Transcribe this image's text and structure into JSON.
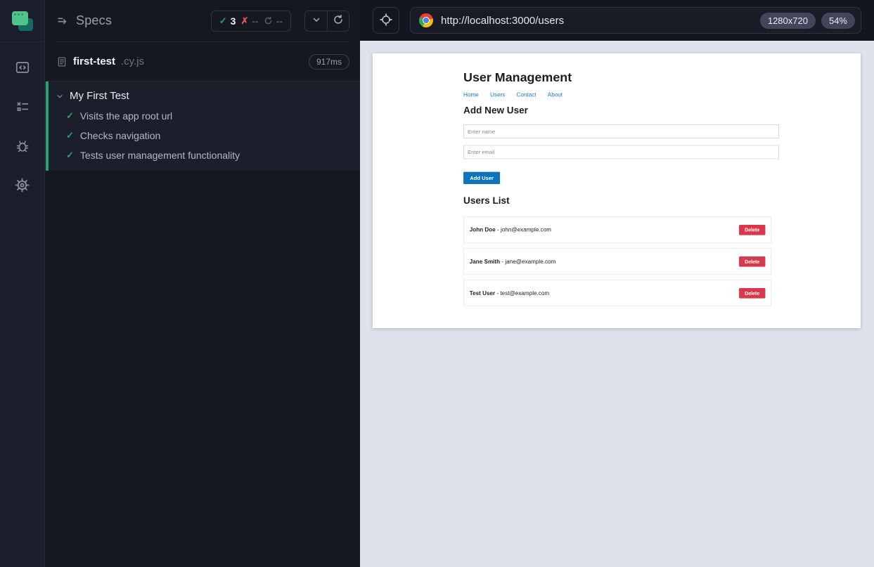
{
  "sidebar": {
    "icons": [
      "cypress-logo",
      "specs-window-icon",
      "runs-checklist-icon",
      "debug-bug-icon",
      "settings-gear-icon"
    ]
  },
  "specs_panel": {
    "title": "Specs",
    "stats": {
      "passed": "3",
      "failed": "--",
      "pending": "--"
    },
    "spec_file": {
      "name": "first-test",
      "extension": ".cy.js",
      "duration": "917ms"
    },
    "suite": {
      "title": "My First Test",
      "tests": [
        {
          "label": "Visits the app root url",
          "status": "passed"
        },
        {
          "label": "Checks navigation",
          "status": "passed"
        },
        {
          "label": "Tests user management functionality",
          "status": "passed"
        }
      ]
    }
  },
  "browser_bar": {
    "url": "http://localhost:3000/users",
    "viewport_size": "1280x720",
    "zoom_level": "54%"
  },
  "aut": {
    "title": "User Management",
    "nav": [
      "Home",
      "Users",
      "Contact",
      "About"
    ],
    "form": {
      "heading": "Add New User",
      "name_placeholder": "Enter name",
      "email_placeholder": "Enter email",
      "submit_label": "Add User"
    },
    "users_list": {
      "heading": "Users List",
      "separator": " - ",
      "delete_label": "Delete",
      "users": [
        {
          "name": "John Doe",
          "email": "john@example.com"
        },
        {
          "name": "Jane Smith",
          "email": "jane@example.com"
        },
        {
          "name": "Test User",
          "email": "test@example.com"
        }
      ]
    }
  },
  "colors": {
    "passed_green": "#1fa971",
    "failed_red": "#e45661",
    "link_blue": "#1a73cf",
    "submit_blue": "#0d74b8",
    "delete_red": "#d9374b",
    "panel_dark": "#16181f",
    "viewport_backdrop": "#dfe1ec"
  }
}
